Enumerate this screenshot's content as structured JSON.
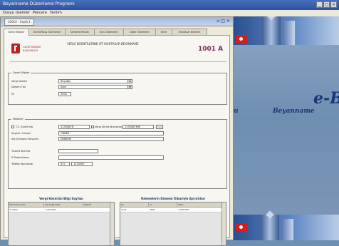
{
  "app": {
    "title": "Beyanname Düzenleme Programı"
  },
  "menu": [
    {
      "label": "Dosya"
    },
    {
      "label": "Islemler"
    },
    {
      "label": "Pencere"
    },
    {
      "label": "Yardım"
    }
  ],
  "window": {
    "doc_tab": "1001A - Sayfa 1",
    "tabs": [
      {
        "label": "Genel Bilgiler"
      },
      {
        "label": "Ücret/Maaş Ödemeleri"
      },
      {
        "label": "Serbest Meslek"
      },
      {
        "label": "Kira Ödemeleri"
      },
      {
        "label": "Diğer Ödemeler"
      },
      {
        "label": "Ekler"
      },
      {
        "label": "Muhtasar Bildirim"
      }
    ]
  },
  "header": {
    "logo_text": "GELİR İDARESİ BAŞKANLIĞI",
    "title": "VERGİ KESİNTİLERİNE AİT MUHTASAR BEYANNAME",
    "form_no": "1001 A"
  },
  "section1": {
    "title": "Genel Bilgiler",
    "fields": [
      {
        "label": "Vergi Dairesi",
        "value": "Beyoğlu"
      },
      {
        "label": "Dönem Tipi",
        "value": "Aylık"
      },
      {
        "label": "Yıl",
        "value": "2004"
      }
    ]
  },
  "section2": {
    "title": "Mükellef",
    "vkn_label": "T.C. Kimlik No",
    "vkn_value": "12345678",
    "tckn_label": "Vergi Kimlik Numarası",
    "tckn_value": "1234567890",
    "name_label": "Soyadı / Unvanı",
    "name_value": "ÖRNEK",
    "firstname_label": "Adı (Unvanın Devamı)",
    "firstname_value": "DENEME",
    "fields": [
      {
        "label": "Ticaret Sicil No",
        "value": ""
      },
      {
        "label": "E-Posta Adresi",
        "value": ""
      },
      {
        "label": "Telefon Numarası",
        "value": "312"
      }
    ],
    "phone_number": "1234567"
  },
  "panel_left": {
    "title": "Vergi Kesintisi Bilgi Sayfası",
    "columns": [
      "Ödemenin Türü",
      "Gayrisafi Tutar",
      "Kesinti"
    ],
    "rows": [
      [
        "Ücretler",
        "1.250.000",
        ""
      ]
    ]
  },
  "panel_right": {
    "title": "Ödemelerin Dönemi İtibariyle Ayrıntıları",
    "columns": [
      "Ay",
      "Yıl",
      "Tutar"
    ],
    "rows": [
      [
        "Ocak",
        "2004",
        "1.250.000"
      ]
    ]
  },
  "desktop": {
    "brand_big": "e-B",
    "brand_sub": "Beyanname",
    "brand_sub_left": "u"
  }
}
